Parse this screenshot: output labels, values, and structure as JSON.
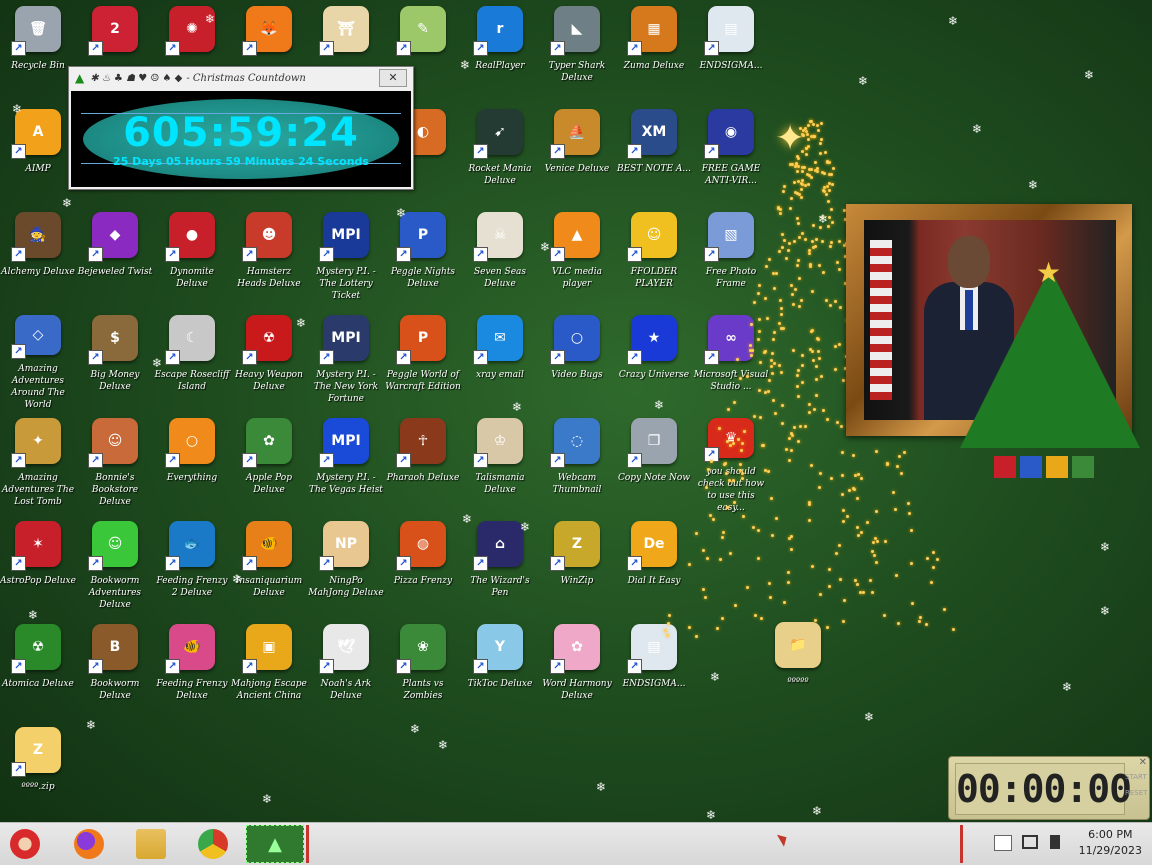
{
  "desktop": {
    "icons": [
      {
        "label": "Recycle Bin",
        "color": "#9aa4ae",
        "glyph": "🗑",
        "pos": 0
      },
      {
        "label": "",
        "color": "#cc2233",
        "glyph": "2",
        "pos": 1
      },
      {
        "label": "",
        "color": "#c8202a",
        "glyph": "✺",
        "pos": 2
      },
      {
        "label": "",
        "color": "#f07a1a",
        "glyph": "🦊",
        "pos": 3
      },
      {
        "label": "",
        "color": "#e8d6a8",
        "glyph": "⛩",
        "pos": 4
      },
      {
        "label": "",
        "color": "#9cc86a",
        "glyph": "✎",
        "pos": 5
      },
      {
        "label": "RealPlayer",
        "color": "#1a7ad8",
        "glyph": "r",
        "pos": 6
      },
      {
        "label": "Typer Shark Deluxe",
        "color": "#6e7f86",
        "glyph": "◣",
        "pos": 7
      },
      {
        "label": "Zuma Deluxe",
        "color": "#d6791c",
        "glyph": "▦",
        "pos": 8
      },
      {
        "label": "ENDSIGMA...",
        "color": "#dfe7ef",
        "glyph": "▤",
        "pos": 9
      },
      {
        "label": "AIMP",
        "color": "#f1a11a",
        "glyph": "A",
        "pos": 10
      },
      {
        "label": "",
        "color": "#d86b24",
        "glyph": "◐",
        "pos": 15
      },
      {
        "label": "Rocket Mania Deluxe",
        "color": "#233b33",
        "glyph": "➹",
        "pos": 16
      },
      {
        "label": "Venice Deluxe",
        "color": "#c88a2a",
        "glyph": "⛵",
        "pos": 17
      },
      {
        "label": "BEST NOTE A...",
        "color": "#2a4c8a",
        "glyph": "XM",
        "pos": 18
      },
      {
        "label": "FREE GAME ANTI-VIR...",
        "color": "#2a3aa0",
        "glyph": "◉",
        "pos": 19
      },
      {
        "label": "Alchemy Deluxe",
        "color": "#6a4a2a",
        "glyph": "🧙",
        "pos": 20
      },
      {
        "label": "Bejeweled Twist",
        "color": "#8a2ac0",
        "glyph": "◆",
        "pos": 21
      },
      {
        "label": "Dynomite Deluxe",
        "color": "#c8202a",
        "glyph": "●",
        "pos": 22
      },
      {
        "label": "Hamsterz Heads Deluxe",
        "color": "#c83a2a",
        "glyph": "☻",
        "pos": 23
      },
      {
        "label": "Mystery P.I. - The Lottery Ticket",
        "color": "#1a3a9a",
        "glyph": "MPI",
        "pos": 24
      },
      {
        "label": "Peggle Nights Deluxe",
        "color": "#2a5ac8",
        "glyph": "P",
        "pos": 25
      },
      {
        "label": "Seven Seas Deluxe",
        "color": "#e6e0d2",
        "glyph": "☠",
        "pos": 26
      },
      {
        "label": "VLC media player",
        "color": "#f08a1a",
        "glyph": "▲",
        "pos": 27
      },
      {
        "label": "FFOLDER PLAYER",
        "color": "#f0c020",
        "glyph": "☺",
        "pos": 28
      },
      {
        "label": "Free Photo Frame",
        "color": "#7a9ad8",
        "glyph": "▧",
        "pos": 29
      },
      {
        "label": "Amazing Adventures Around The World",
        "color": "#3a6ac8",
        "glyph": "◇",
        "pos": 30
      },
      {
        "label": "Big Money Deluxe",
        "color": "#8a6a3a",
        "glyph": "$",
        "pos": 31
      },
      {
        "label": "Escape Rosecliff Island",
        "color": "#c8c8c8",
        "glyph": "☾",
        "pos": 32
      },
      {
        "label": "Heavy Weapon Deluxe",
        "color": "#c81a1a",
        "glyph": "☢",
        "pos": 33
      },
      {
        "label": "Mystery P.I. - The New York Fortune",
        "color": "#2a3a6a",
        "glyph": "MPI",
        "pos": 34
      },
      {
        "label": "Peggle World of Warcraft Edition",
        "color": "#d8501a",
        "glyph": "P",
        "pos": 35
      },
      {
        "label": "xray email",
        "color": "#1a8ae0",
        "glyph": "✉",
        "pos": 36
      },
      {
        "label": "Video Bugs",
        "color": "#2a5ac8",
        "glyph": "○",
        "pos": 37
      },
      {
        "label": "Crazy Universe",
        "color": "#1a3ad8",
        "glyph": "★",
        "pos": 38
      },
      {
        "label": "Microsoft Visual Studio ...",
        "color": "#6a3ac8",
        "glyph": "∞",
        "pos": 39
      },
      {
        "label": "Amazing Adventures The Lost Tomb",
        "color": "#c89a3a",
        "glyph": "✦",
        "pos": 40
      },
      {
        "label": "Bonnie's Bookstore Deluxe",
        "color": "#c86a3a",
        "glyph": "☺",
        "pos": 41
      },
      {
        "label": "Everything",
        "color": "#f08a1a",
        "glyph": "○",
        "pos": 42
      },
      {
        "label": "Apple Pop Deluxe",
        "color": "#3a8a3a",
        "glyph": "✿",
        "pos": 43
      },
      {
        "label": "Mystery P.I. - The Vegas Heist",
        "color": "#1a4ad8",
        "glyph": "MPI",
        "pos": 44
      },
      {
        "label": "Pharaoh Deluxe",
        "color": "#8a3a1a",
        "glyph": "☥",
        "pos": 45
      },
      {
        "label": "Talismania Deluxe",
        "color": "#d8c8a8",
        "glyph": "♔",
        "pos": 46
      },
      {
        "label": "Webcam Thumbnail",
        "color": "#3a7ac8",
        "glyph": "◌",
        "pos": 47
      },
      {
        "label": "Copy Note Now",
        "color": "#9aa4ae",
        "glyph": "❐",
        "pos": 48
      },
      {
        "label": "you should check out how to use this easy...",
        "color": "#d82a1a",
        "glyph": "♛",
        "pos": 49
      },
      {
        "label": "AstroPop Deluxe",
        "color": "#c8202a",
        "glyph": "✶",
        "pos": 50
      },
      {
        "label": "Bookworm Adventures Deluxe",
        "color": "#3ac83a",
        "glyph": "☺",
        "pos": 51
      },
      {
        "label": "Feeding Frenzy 2 Deluxe",
        "color": "#1a7ac8",
        "glyph": "🐟",
        "pos": 52
      },
      {
        "label": "Insaniquarium Deluxe",
        "color": "#e8801a",
        "glyph": "🐠",
        "pos": 53
      },
      {
        "label": "NingPo MahJong Deluxe",
        "color": "#e8c890",
        "glyph": "NP",
        "pos": 54
      },
      {
        "label": "Pizza Frenzy",
        "color": "#d8501a",
        "glyph": "◍",
        "pos": 55
      },
      {
        "label": "The Wizard's Pen",
        "color": "#2a2a6a",
        "glyph": "⌂",
        "pos": 56
      },
      {
        "label": "WinZip",
        "color": "#c8a82a",
        "glyph": "Z",
        "pos": 57
      },
      {
        "label": "Dial It Easy",
        "color": "#f0a81a",
        "glyph": "De",
        "pos": 58
      },
      {
        "label": "Atomica Deluxe",
        "color": "#2a8a2a",
        "glyph": "☢",
        "pos": 60
      },
      {
        "label": "Bookworm Deluxe",
        "color": "#8a5a2a",
        "glyph": "B",
        "pos": 61
      },
      {
        "label": "Feeding Frenzy Deluxe",
        "color": "#d84a8a",
        "glyph": "🐠",
        "pos": 62
      },
      {
        "label": "Mahjong Escape Ancient China",
        "color": "#e8a81a",
        "glyph": "▣",
        "pos": 63
      },
      {
        "label": "Noah's Ark Deluxe",
        "color": "#e8e8e8",
        "glyph": "🕊",
        "pos": 64
      },
      {
        "label": "Plants vs Zombies",
        "color": "#3a8a3a",
        "glyph": "❀",
        "pos": 65
      },
      {
        "label": "TikToc Deluxe",
        "color": "#8ac8e8",
        "glyph": "Y",
        "pos": 66
      },
      {
        "label": "Word Harmony Deluxe",
        "color": "#f0a8c8",
        "glyph": "✿",
        "pos": 67
      },
      {
        "label": "ENDSIGMA...",
        "color": "#dfe7ef",
        "glyph": "▤",
        "pos": 68
      },
      {
        "label": "ºººº.zip",
        "color": "#f4d06a",
        "glyph": "Z",
        "pos": 70
      }
    ],
    "folder": {
      "label": "ººººº",
      "color": "#e8d08a"
    }
  },
  "countdown_window": {
    "title": "- Christmas Countdown",
    "close_label": "✕",
    "big_time": "605:59:24",
    "long_time": "25 Days 05 Hours 59 Minutes 24 Seconds"
  },
  "stopwatch": {
    "display": "00:00:00",
    "start_label": "START",
    "reset_label": "RESET",
    "close_label": "✕"
  },
  "taskbar": {
    "clock_time": "6:00 PM",
    "clock_date": "11/29/2023",
    "apps": [
      {
        "name": "santa",
        "color": "#d82a2a"
      },
      {
        "name": "firefox",
        "color": "#f07a1a"
      },
      {
        "name": "explorer",
        "color": "#e8c060"
      },
      {
        "name": "chrome",
        "color": "#3aa84a"
      },
      {
        "name": "christmas-countdown",
        "color": "#2f7a2f"
      }
    ]
  }
}
